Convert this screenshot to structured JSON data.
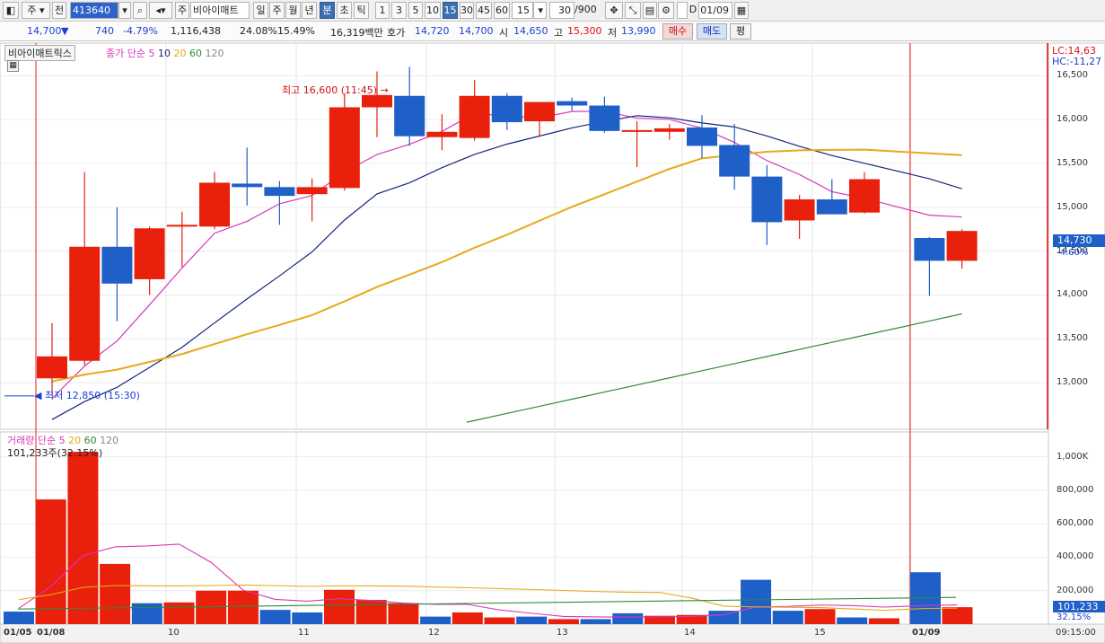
{
  "toolbar": {
    "market": "주",
    "prev": "전",
    "code": "413640",
    "stock_name": "비아이매트",
    "periods": [
      "일",
      "주",
      "월",
      "년",
      "분",
      "초",
      "틱"
    ],
    "active_period": "분",
    "intervals": [
      "1",
      "3",
      "5",
      "10",
      "15",
      "30",
      "45",
      "60"
    ],
    "active_interval": "15",
    "interval_select": "15",
    "count": "30",
    "count_max": "/900",
    "date_checkbox_label": "D",
    "date": "01/09"
  },
  "quote": {
    "price": "14,700",
    "change": "740",
    "change_pct": "-4.79%",
    "volume": "1,116,438",
    "vol_ratio": "24.08%",
    "turnover": "15.49%",
    "amount": "16,319백만",
    "ask_label": "호가",
    "ask1": "14,720",
    "ask2": "14,700",
    "open_label": "시",
    "open": "14,650",
    "high_label": "고",
    "high": "15,300",
    "low_label": "저",
    "low": "13,990",
    "buy_label": "매수",
    "sell_label": "매도",
    "eval_label": "평"
  },
  "price_panel": {
    "name": "비아이매트릭스",
    "ma_label": "종가 단순",
    "ma_periods": [
      "5",
      "10",
      "20",
      "60",
      "120"
    ],
    "lc": "LC:14,63",
    "hc": "HC:-11,27",
    "current": "14,730",
    "current_pct": "-4.60%",
    "high_note": "최고 16,600 (11:45)",
    "low_note": "최저 12,850 (15:30)",
    "y_ticks": [
      "16,500",
      "16,000",
      "15,500",
      "15,000",
      "14,500",
      "14,000",
      "13,500",
      "13,000"
    ]
  },
  "volume_panel": {
    "label": "거래량",
    "ma_label": "단순",
    "ma_periods": [
      "5",
      "20",
      "60",
      "120"
    ],
    "readout": "101,233주(32.15%)",
    "current": "101,233",
    "current_pct": "32.15%",
    "y_ticks": [
      "1,000K",
      "800,000",
      "600,000",
      "400,000",
      "200,000"
    ]
  },
  "x_axis": {
    "labels": [
      "01/05",
      "01/08",
      "10",
      "11",
      "12",
      "13",
      "14",
      "15",
      "01/09"
    ],
    "end_time": "09:15:00"
  },
  "colors": {
    "up": "#e8200c",
    "down": "#1f5fc8",
    "ma5": "#d838b8",
    "ma10": "#15257a",
    "ma20": "#e8a81a",
    "ma60": "#2e8a3a"
  },
  "chart_data": {
    "type": "candlestick",
    "candles": [
      {
        "o": 13050,
        "h": 13680,
        "l": 12850,
        "c": 13300
      },
      {
        "o": 13250,
        "h": 15400,
        "l": 13200,
        "c": 14550
      },
      {
        "o": 14550,
        "h": 15000,
        "l": 13700,
        "c": 14130
      },
      {
        "o": 14180,
        "h": 14780,
        "l": 14000,
        "c": 14760
      },
      {
        "o": 14780,
        "h": 14950,
        "l": 14320,
        "c": 14800
      },
      {
        "o": 14780,
        "h": 15400,
        "l": 14750,
        "c": 15280
      },
      {
        "o": 15270,
        "h": 15680,
        "l": 15020,
        "c": 15230
      },
      {
        "o": 15230,
        "h": 15300,
        "l": 14800,
        "c": 15130
      },
      {
        "o": 15150,
        "h": 15330,
        "l": 14840,
        "c": 15230
      },
      {
        "o": 15220,
        "h": 16300,
        "l": 15190,
        "c": 16140
      },
      {
        "o": 16140,
        "h": 16550,
        "l": 15800,
        "c": 16280
      },
      {
        "o": 16270,
        "h": 16600,
        "l": 15700,
        "c": 15810
      },
      {
        "o": 15800,
        "h": 16060,
        "l": 15650,
        "c": 15860
      },
      {
        "o": 15790,
        "h": 16450,
        "l": 15760,
        "c": 16270
      },
      {
        "o": 16270,
        "h": 16300,
        "l": 15880,
        "c": 15970
      },
      {
        "o": 15980,
        "h": 16190,
        "l": 15810,
        "c": 16200
      },
      {
        "o": 16210,
        "h": 16250,
        "l": 16100,
        "c": 16160
      },
      {
        "o": 16160,
        "h": 16260,
        "l": 15850,
        "c": 15870
      },
      {
        "o": 15880,
        "h": 15980,
        "l": 15460,
        "c": 15880
      },
      {
        "o": 15860,
        "h": 15950,
        "l": 15770,
        "c": 15900
      },
      {
        "o": 15910,
        "h": 16050,
        "l": 15560,
        "c": 15700
      },
      {
        "o": 15710,
        "h": 15950,
        "l": 15200,
        "c": 15350
      },
      {
        "o": 15350,
        "h": 15480,
        "l": 14570,
        "c": 14830
      },
      {
        "o": 14850,
        "h": 15140,
        "l": 14640,
        "c": 15090
      },
      {
        "o": 15090,
        "h": 15320,
        "l": 14940,
        "c": 14920
      },
      {
        "o": 14940,
        "h": 15400,
        "l": 14930,
        "c": 15320
      },
      {
        "o": 14650,
        "h": 14660,
        "l": 13990,
        "c": 14390
      },
      {
        "o": 14390,
        "h": 14750,
        "l": 14300,
        "c": 14730
      }
    ],
    "gap_after_index": 25,
    "volume": [
      75000,
      745000,
      1030000,
      360000,
      125000,
      130000,
      200000,
      200000,
      85000,
      70000,
      205000,
      145000,
      125000,
      45000,
      70000,
      40000,
      45000,
      30000,
      30000,
      65000,
      50000,
      55000,
      80000,
      265000,
      80000,
      90000,
      40000,
      35000,
      310000,
      101233
    ],
    "ylim_price": [
      12500,
      16800
    ],
    "ylim_volume": [
      0,
      1100000
    ]
  }
}
